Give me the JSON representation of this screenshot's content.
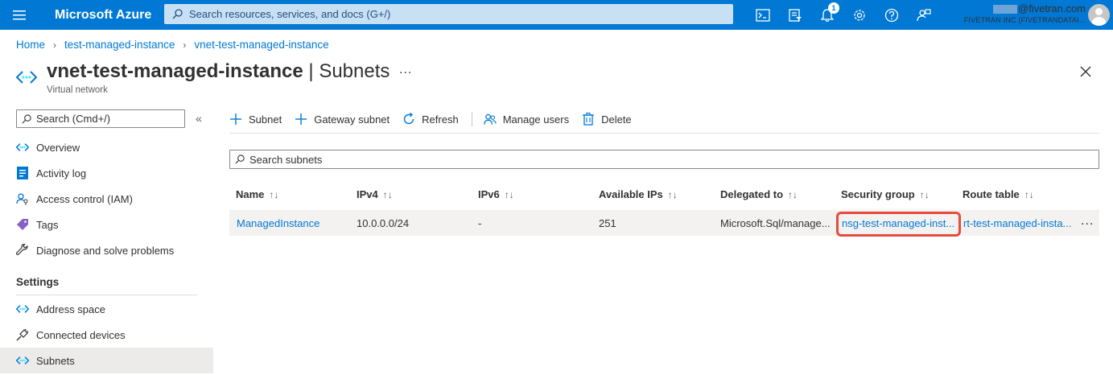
{
  "topbar": {
    "brand": "Microsoft Azure",
    "search_placeholder": "Search resources, services, and docs (G+/)",
    "notification_count": "1",
    "account_email": "@fivetran.com",
    "account_tenant": "FIVETRAN INC (FIVETRANDATAI..."
  },
  "breadcrumb": [
    "Home",
    "test-managed-instance",
    "vnet-test-managed-instance"
  ],
  "page": {
    "resource_name": "vnet-test-managed-instance",
    "separator": " | ",
    "blade_name": "Subnets",
    "more": "...",
    "subtitle": "Virtual network"
  },
  "nav": {
    "search_placeholder": "Search (Cmd+/)",
    "collapse": "«",
    "items": [
      {
        "label": "Overview",
        "icon": "vnet-icon"
      },
      {
        "label": "Activity log",
        "icon": "activity-log-icon"
      },
      {
        "label": "Access control (IAM)",
        "icon": "iam-icon"
      },
      {
        "label": "Tags",
        "icon": "tag-icon"
      },
      {
        "label": "Diagnose and solve problems",
        "icon": "wrench-icon"
      }
    ],
    "section": "Settings",
    "settings_items": [
      {
        "label": "Address space",
        "icon": "vnet-icon"
      },
      {
        "label": "Connected devices",
        "icon": "plug-icon"
      },
      {
        "label": "Subnets",
        "icon": "vnet-icon",
        "active": true
      }
    ]
  },
  "toolbar": {
    "subnet": "Subnet",
    "gateway_subnet": "Gateway subnet",
    "refresh": "Refresh",
    "manage_users": "Manage users",
    "delete": "Delete"
  },
  "subnet_search_placeholder": "Search subnets",
  "table": {
    "sort_glyph": "↑↓",
    "columns": [
      "Name",
      "IPv4",
      "IPv6",
      "Available IPs",
      "Delegated to",
      "Security group",
      "Route table"
    ],
    "rows": [
      {
        "name": "ManagedInstance",
        "ipv4": "10.0.0.0/24",
        "ipv6": "-",
        "available_ips": "251",
        "delegated_to": "Microsoft.Sql/manage...",
        "security_group": "nsg-test-managed-inst...",
        "route_table": "rt-test-managed-insta...",
        "more": "..."
      }
    ]
  },
  "colors": {
    "accent": "#0078d4",
    "highlight": "#e74c3c"
  }
}
